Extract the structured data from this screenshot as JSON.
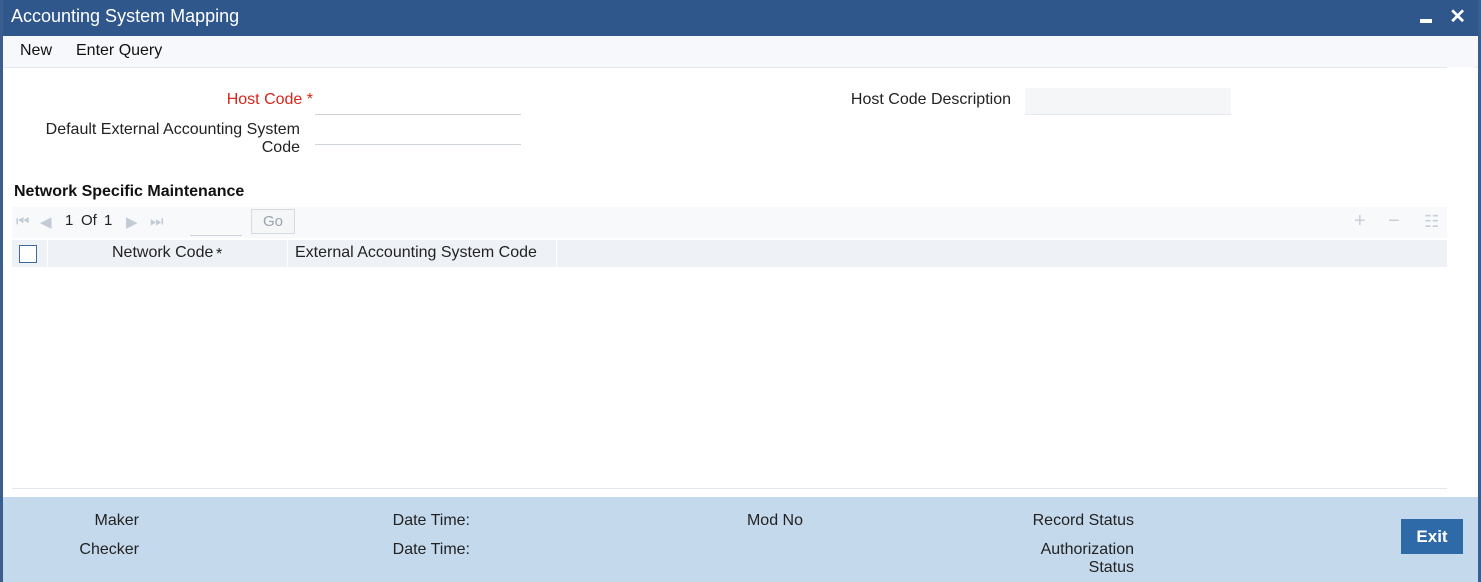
{
  "window": {
    "title": "Accounting System Mapping",
    "minimize_label": "",
    "close_label": "✕"
  },
  "toolbar": {
    "new_label": "New",
    "enter_query_label": "Enter Query"
  },
  "form": {
    "host_code_label": "Host Code",
    "required_marker": "*",
    "host_code_value": "",
    "host_code_description_label": "Host Code Description",
    "host_code_description_value": "",
    "default_ext_acc_label_line1": "Default External Accounting System",
    "default_ext_acc_label_line2": "Code",
    "default_ext_acc_value": ""
  },
  "network": {
    "section_title": "Network Specific Maintenance",
    "pager": {
      "current": "1",
      "of_label": "Of",
      "total": "1",
      "page_input_value": "",
      "go_label": "Go"
    },
    "columns": [
      {
        "label": "Network Code",
        "required": true
      },
      {
        "label": "External Accounting System Code",
        "required": false
      }
    ],
    "rows": []
  },
  "footer": {
    "maker_label": "Maker",
    "checker_label": "Checker",
    "date_time_label": "Date Time:",
    "mod_no_label": "Mod No",
    "record_status_label": "Record Status",
    "authorization_label_line1": "Authorization",
    "authorization_label_line2": "Status",
    "exit_label": "Exit"
  },
  "colors": {
    "title_bar": "#2f578b",
    "required": "#d7261c",
    "footer_bg": "#c5d9ec",
    "exit_button": "#2f6aa8"
  }
}
